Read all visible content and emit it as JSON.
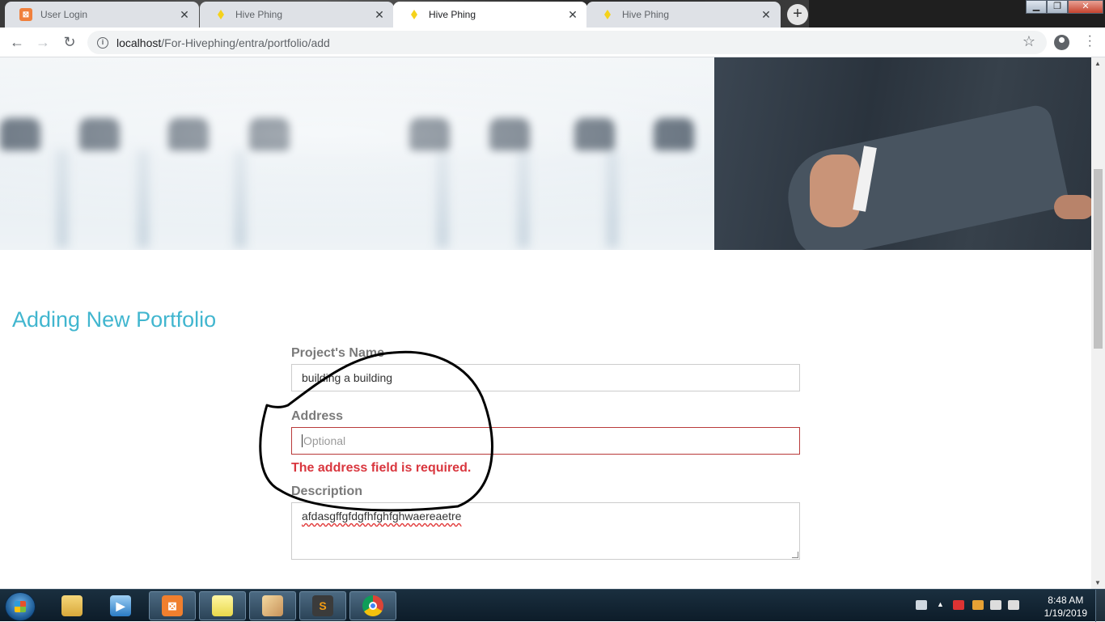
{
  "browser": {
    "tabs": [
      {
        "label": "User Login",
        "favicon": "xampp-icon",
        "active": false
      },
      {
        "label": "Hive Phing",
        "favicon": "hive-icon",
        "active": false
      },
      {
        "label": "Hive Phing",
        "favicon": "hive-icon",
        "active": true
      },
      {
        "label": "Hive Phing",
        "favicon": "hive-icon",
        "active": false
      }
    ],
    "url_host": "localhost",
    "url_path": "/For-Hivephing/entra/portfolio/add"
  },
  "page": {
    "title": "Adding New Portfolio",
    "form": {
      "project_name_label": "Project's Name",
      "project_name_value": "building a building",
      "address_label": "Address",
      "address_placeholder": "Optional",
      "address_error": "The address field is required.",
      "description_label": "Description",
      "description_value": "afdasgffgfdgfhfghfghwaereaetre"
    }
  },
  "taskbar": {
    "time": "8:48 AM",
    "date": "1/19/2019"
  },
  "colors": {
    "title": "#41b6cf",
    "error": "#d9363e",
    "label": "#7a7a7a"
  }
}
